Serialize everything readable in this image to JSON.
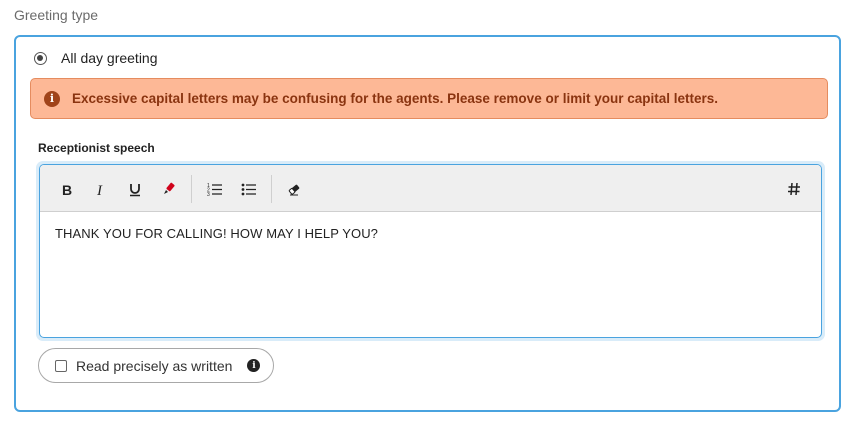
{
  "section": {
    "label": "Greeting type"
  },
  "greeting_option": {
    "label": "All day greeting",
    "selected": true
  },
  "alert": {
    "icon": "info-circle-icon",
    "message": "Excessive capital letters may be confusing for the agents. Please remove or limit your capital letters.",
    "color": "#fdb896"
  },
  "editor": {
    "label": "Receptionist speech",
    "toolbar": [
      "bold-icon",
      "italic-icon",
      "underline-icon",
      "highlighter-icon",
      "ordered-list-icon",
      "bullet-list-icon",
      "eraser-icon",
      "hash-icon"
    ],
    "content": "THANK YOU FOR CALLING! HOW MAY I HELP YOU?"
  },
  "read_precisely": {
    "label": "Read precisely as written",
    "checked": false,
    "info_icon": "info-icon"
  },
  "colors": {
    "accent": "#4aa3df",
    "alert_text": "#8a3410"
  }
}
